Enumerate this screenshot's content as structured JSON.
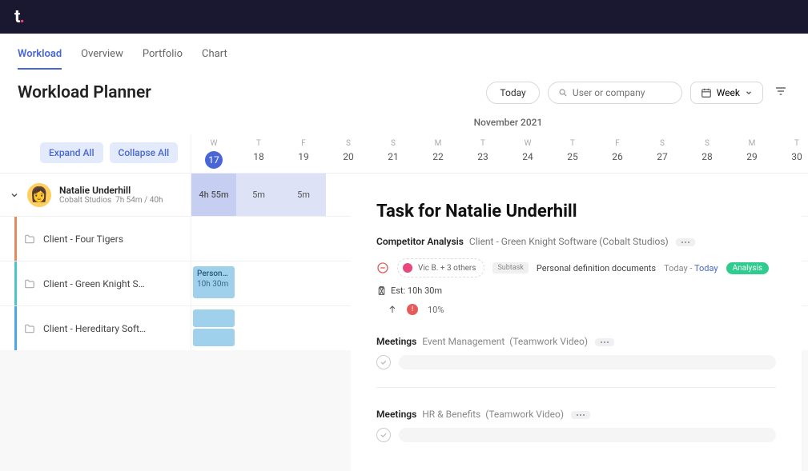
{
  "logo": {
    "text": "t",
    "dot": "."
  },
  "tabs": [
    {
      "label": "Workload",
      "active": true
    },
    {
      "label": "Overview"
    },
    {
      "label": "Portfolio"
    },
    {
      "label": "Chart"
    }
  ],
  "page_title": "Workload Planner",
  "controls": {
    "today_label": "Today",
    "search_placeholder": "User or company",
    "view_label": "Week"
  },
  "month_label": "November 2021",
  "actions": {
    "expand": "Expand All",
    "collapse": "Collapse All"
  },
  "days": [
    {
      "letter": "W",
      "num": "17",
      "today": true
    },
    {
      "letter": "T",
      "num": "18"
    },
    {
      "letter": "F",
      "num": "19"
    },
    {
      "letter": "S",
      "num": "20"
    },
    {
      "letter": "S",
      "num": "21"
    },
    {
      "letter": "M",
      "num": "22"
    },
    {
      "letter": "T",
      "num": "23"
    },
    {
      "letter": "W",
      "num": "24"
    },
    {
      "letter": "T",
      "num": "25"
    },
    {
      "letter": "F",
      "num": "26"
    },
    {
      "letter": "S",
      "num": "27"
    },
    {
      "letter": "S",
      "num": "28"
    },
    {
      "letter": "M",
      "num": "29"
    },
    {
      "letter": "T",
      "num": "30"
    }
  ],
  "user": {
    "name": "Natalie Underhill",
    "company": "Cobalt Studios",
    "hours": "7h 54m / 40h",
    "loads": [
      "4h 55m",
      "5m",
      "5m"
    ]
  },
  "clients": [
    {
      "name": "Client - Four Tigers",
      "color": "#e58b5a"
    },
    {
      "name": "Client - Green Knight S…",
      "color": "#4ac6c6",
      "task": {
        "title": "Personal …",
        "time": "10h 30m"
      }
    },
    {
      "name": "Client - Hereditary Soft…",
      "color": "#4aa7e8",
      "blocks": true
    }
  ],
  "detail": {
    "title": "Task for Natalie Underhill",
    "task_name": "Competitor Analysis",
    "breadcrumb": "Client - Green Knight Software (Cobalt Studios)",
    "assignees": "Vic B. + 3 others",
    "subtask_label": "Subtask",
    "subtask_name": "Personal definition documents",
    "date_prefix": "Today - ",
    "date_link": "Today",
    "tag": "Analysis",
    "estimate_label": "Est: 10h 30m",
    "progress": "10%",
    "meetings_label": "Meetings",
    "meeting1_name": "Event Management",
    "meeting1_ctx": "(Teamwork Video)",
    "meeting2_name": "HR & Benefits",
    "meeting2_ctx": "(Teamwork Video)"
  }
}
